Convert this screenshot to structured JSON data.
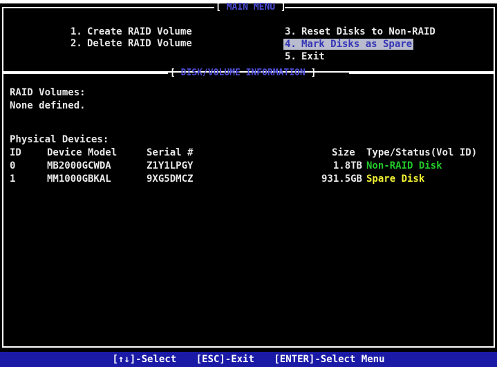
{
  "main_menu": {
    "title": "MAIN MENU",
    "items": [
      {
        "number": "1.",
        "label": "Create RAID Volume"
      },
      {
        "number": "2.",
        "label": "Delete RAID Volume"
      },
      {
        "number": "3.",
        "label": "Reset Disks to Non-RAID"
      },
      {
        "number": "4.",
        "label": "Mark Disks as Spare",
        "selected": true
      },
      {
        "number": "5.",
        "label": "Exit"
      }
    ]
  },
  "disk_info": {
    "title": "DISK/VOLUME INFORMATION",
    "raid_volumes_heading": "RAID Volumes:",
    "raid_volumes_value": "None defined.",
    "physical_devices_heading": "Physical Devices:",
    "columns": {
      "id": "ID",
      "model": "Device Model",
      "serial": "Serial #",
      "size": "Size",
      "status": "Type/Status(Vol ID)"
    },
    "devices": [
      {
        "id": "0",
        "model": "MB2000GCWDA",
        "serial": "Z1Y1LPGY",
        "size": "1.8TB",
        "status": "Non-RAID Disk",
        "status_color": "#22c92a"
      },
      {
        "id": "1",
        "model": "MM1000GBKAL",
        "serial": "9XG5DMCZ",
        "size": "931.5GB",
        "status": "Spare Disk",
        "status_color": "#f2f234"
      }
    ]
  },
  "footer": {
    "select_hint": "[↑↓]-Select",
    "exit_hint": "[ESC]-Exit",
    "enter_hint": "[ENTER]-Select Menu"
  },
  "colors": {
    "background": "#000000",
    "footer_bar": "#1a1aa6",
    "title_text": "#4d4dd6",
    "selected_bg": "#b9bccd"
  }
}
